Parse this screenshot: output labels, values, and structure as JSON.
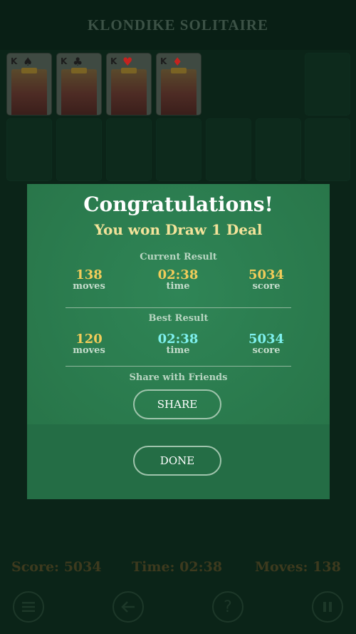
{
  "app": {
    "title": "KLONDIKE SOLITAIRE"
  },
  "foundations": [
    {
      "rank": "K",
      "suit": "♠",
      "suit_color": "#1c1c1c"
    },
    {
      "rank": "K",
      "suit": "♣",
      "suit_color": "#1c1c1c"
    },
    {
      "rank": "K",
      "suit": "♥",
      "suit_color": "#c4231f"
    },
    {
      "rank": "K",
      "suit": "♦",
      "suit_color": "#c4231f"
    }
  ],
  "dialog": {
    "title": "Congratulations!",
    "subtitle": "You won Draw 1 Deal",
    "current": {
      "heading": "Current Result",
      "moves": "138",
      "moves_label": "moves",
      "time": "02:38",
      "time_label": "time",
      "score": "5034",
      "score_label": "score"
    },
    "best": {
      "heading": "Best Result",
      "moves": "120",
      "moves_label": "moves",
      "time": "02:38",
      "time_label": "time",
      "score": "5034",
      "score_label": "score"
    },
    "share_heading": "Share with Friends",
    "share_button": "SHARE",
    "done_button": "DONE"
  },
  "status": {
    "score": "Score: 5034",
    "time": "Time: 02:38",
    "moves": "Moves: 138"
  },
  "toolbar": {
    "menu_icon": "menu-icon",
    "undo_icon": "undo-icon",
    "help_icon": "help-icon",
    "pause_icon": "pause-icon"
  },
  "colors": {
    "table_bg": "#0b2418",
    "dialog_bg": "#2a7a4f",
    "highlight_yellow": "#f2cc5a",
    "highlight_cyan": "#7ef0ee"
  }
}
